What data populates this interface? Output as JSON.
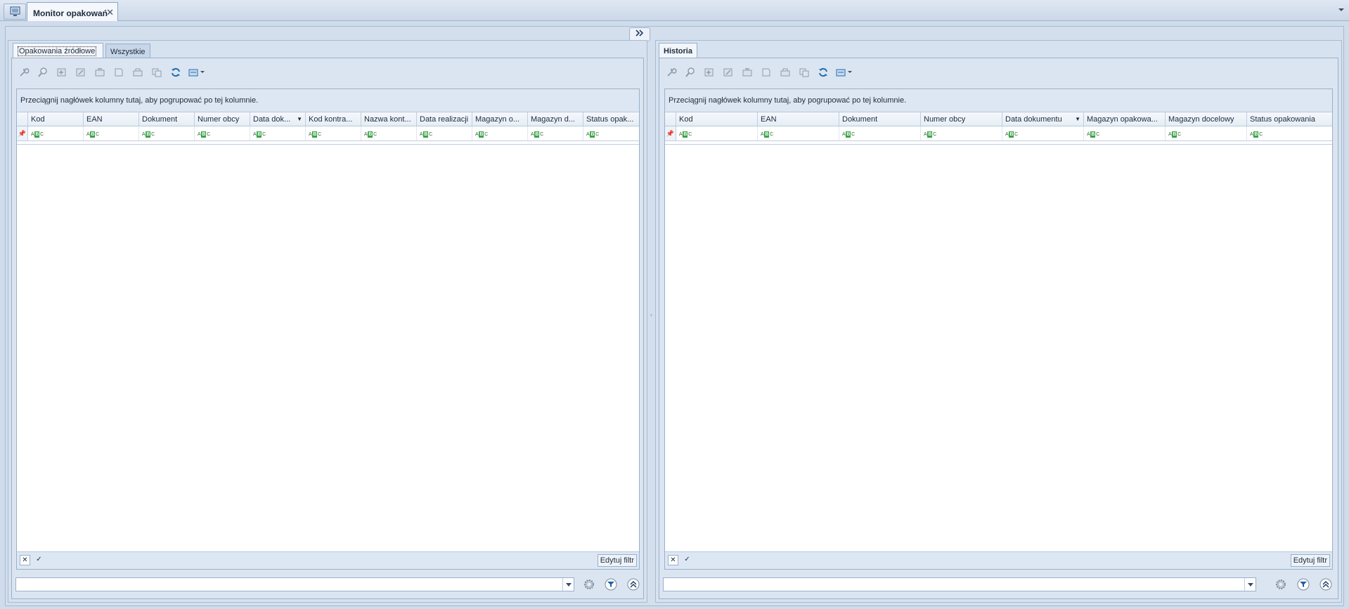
{
  "window": {
    "tab_title": "Monitor opakowań",
    "close_glyph": "✕"
  },
  "left_panel": {
    "tabs": [
      {
        "label": "Opakowania źródłowe",
        "active": true
      },
      {
        "label": "Wszystkie",
        "active": false
      }
    ],
    "group_hint": "Przeciągnij nagłówek kolumny tutaj, aby pogrupować po tej kolumnie.",
    "columns": [
      "Kod",
      "EAN",
      "Dokument",
      "Numer obcy",
      "Data dok...",
      "Kod kontra...",
      "Nazwa kont...",
      "Data realizacji",
      "Magazyn o...",
      "Magazyn d...",
      "Status opak..."
    ],
    "sorted_column": "Data dok...",
    "edit_filter_label": "Edytuj filtr"
  },
  "right_panel": {
    "tabs": [
      {
        "label": "Historia",
        "active": true
      }
    ],
    "group_hint": "Przeciągnij nagłówek kolumny tutaj, aby pogrupować po tej kolumnie.",
    "columns": [
      "Kod",
      "EAN",
      "Dokument",
      "Numer obcy",
      "Data dokumentu",
      "Magazyn opakowa...",
      "Magazyn docelowy",
      "Status opakowania"
    ],
    "sorted_column": "Data dokumentu",
    "edit_filter_label": "Edytuj filtr"
  },
  "toolbar_icons": [
    "wrench-icon",
    "preview-icon",
    "add-icon",
    "edit-icon",
    "delete-icon",
    "print-icon",
    "export-icon",
    "copy-icon",
    "refresh-icon",
    "view-options-icon"
  ],
  "filter_row_glyph": "ABC",
  "colors": {
    "background": "#cfdceb",
    "accent": "#1f6fb3",
    "abc_green": "#3ca34a"
  }
}
